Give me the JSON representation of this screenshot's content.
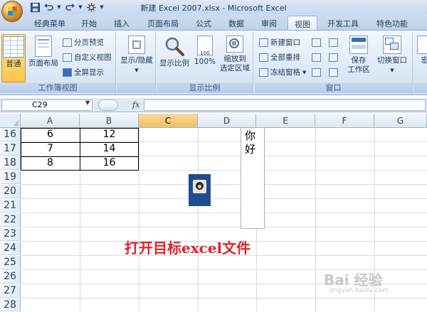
{
  "window": {
    "title": "新建 Excel 2007.xlsx - Microsoft Excel"
  },
  "quick_access": {
    "icons": [
      "save-icon",
      "undo-icon",
      "redo-icon",
      "customize-icon"
    ]
  },
  "tabs": [
    "经典菜单",
    "开始",
    "插入",
    "页面布局",
    "公式",
    "数据",
    "审阅",
    "视图",
    "开发工具",
    "特色功能"
  ],
  "active_tab": "视图",
  "ribbon": {
    "workbook_views": {
      "label": "工作簿视图",
      "normal": "普通",
      "page_layout": "页面布局",
      "page_break": "分页预览",
      "custom_views": "自定义视图",
      "full_screen": "全屏显示"
    },
    "show_hide": {
      "label": "显示/隐藏"
    },
    "zoom": {
      "label": "显示比例",
      "zoom": "显示比例",
      "hundred": "100%",
      "zoom_to_selection_1": "缩放到",
      "zoom_to_selection_2": "选定区域",
      "icon_text": "100"
    },
    "window": {
      "label": "窗口",
      "new_window": "新建窗口",
      "arrange_all": "全部重排",
      "freeze_panes": "冻结窗格",
      "save_workspace_1": "保存",
      "save_workspace_2": "工作区",
      "switch_windows": "切换窗口",
      "macros_partial": "宏"
    }
  },
  "formula_bar": {
    "name_box": "C29",
    "fx": "fx",
    "formula": ""
  },
  "columns": [
    "A",
    "B",
    "C",
    "D",
    "E",
    "F",
    "G"
  ],
  "selected_column": "C",
  "rows": [
    "16",
    "17",
    "18",
    "19",
    "20",
    "21",
    "22",
    "23",
    "24",
    "25",
    "26",
    "27",
    "28"
  ],
  "cells": {
    "a16": "6",
    "b16": "12",
    "a17": "7",
    "b17": "14",
    "a18": "8",
    "b18": "16"
  },
  "textbox": {
    "line1": "你",
    "line2": "好"
  },
  "annotation": "打开目标excel文件",
  "watermark": {
    "main": "Bai 经验",
    "sub": "jingyan.baidu.com"
  }
}
